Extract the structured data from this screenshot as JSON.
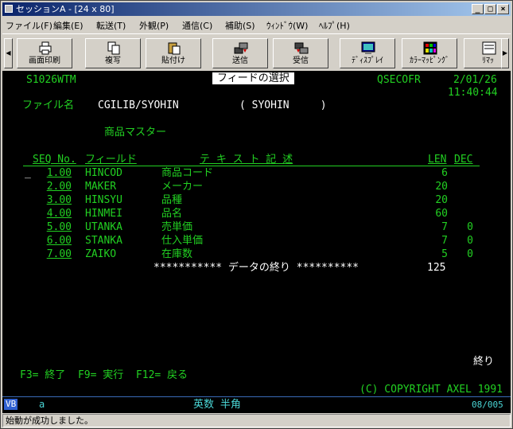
{
  "window": {
    "title": "セッションA - [24 x 80]"
  },
  "menu": [
    "ファイル(F)",
    "編集(E)",
    "転送(T)",
    "外観(P)",
    "通信(C)",
    "補助(S)",
    "ｳｨﾝﾄﾞｳ(W)",
    "ﾍﾙﾌﾟ(H)"
  ],
  "toolbar": [
    {
      "label": "画面印刷",
      "icon": "printer-icon"
    },
    {
      "label": "複写",
      "icon": "copy-icon"
    },
    {
      "label": "貼付け",
      "icon": "paste-icon"
    },
    {
      "label": "送信",
      "icon": "send-icon"
    },
    {
      "label": "受信",
      "icon": "receive-icon"
    },
    {
      "label": "ﾃﾞｨｽﾌﾟﾚｲ",
      "icon": "display-icon"
    },
    {
      "label": "ｶﾗｰﾏｯﾋﾟﾝｸﾞ",
      "icon": "color-mapping-icon"
    },
    {
      "label": "ﾘﾏｯ",
      "icon": "remap-icon"
    }
  ],
  "screen": {
    "program_id": "S1026WTM",
    "title": "フィードの選択",
    "system": "QSECOFR",
    "date": "2/01/26",
    "time": "11:40:44",
    "file_label": "ファイル名",
    "file_name": "CGILIB/SYOHIN",
    "member": "( SYOHIN     )",
    "file_desc": "商品マスター",
    "col_seq": "SEQ No.",
    "col_field": "フィールド",
    "col_text": "テ キ ス ト 記 述",
    "col_len": "LEN",
    "col_dec": "DEC",
    "rows": [
      {
        "seq": "1.00",
        "field": "HINCOD",
        "text": "商品コード",
        "len": "6",
        "dec": ""
      },
      {
        "seq": "2.00",
        "field": "MAKER",
        "text": "メーカー",
        "len": "20",
        "dec": ""
      },
      {
        "seq": "3.00",
        "field": "HINSYU",
        "text": "品種",
        "len": "20",
        "dec": ""
      },
      {
        "seq": "4.00",
        "field": "HINMEI",
        "text": "品名",
        "len": "60",
        "dec": ""
      },
      {
        "seq": "5.00",
        "field": "UTANKA",
        "text": "売単価",
        "len": "7",
        "dec": "0"
      },
      {
        "seq": "6.00",
        "field": "STANKA",
        "text": "仕入単価",
        "len": "7",
        "dec": "0"
      },
      {
        "seq": "7.00",
        "field": "ZAIKO",
        "text": "在庫数",
        "len": "5",
        "dec": "0"
      }
    ],
    "end_line": "*********** データの終り **********",
    "total_len": "125",
    "end_mark": "終り",
    "fkeys": "F3= 終了  F9= 実行  F12= 戻る",
    "copyright": "(C) COPYRIGHT AXEL 1991"
  },
  "status": {
    "mode": "VB",
    "indicator": "a",
    "input_mode": "英数 半角",
    "position": "08/005",
    "message": "始動が成功しました。"
  }
}
